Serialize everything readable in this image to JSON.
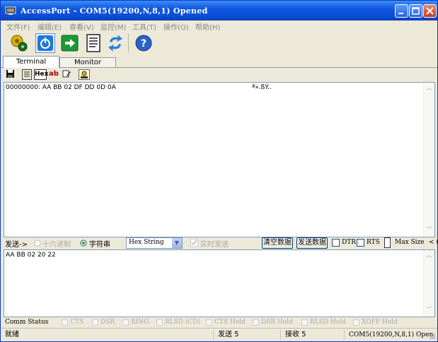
{
  "window": {
    "title": "AccessPort - COM5(19200,N,8,1) Opened"
  },
  "menu": [
    "文件(F)",
    "编辑(E)",
    "查看(V)",
    "监控(M)",
    "工具(T)",
    "操作(O)",
    "帮助(H)"
  ],
  "tabs": {
    "terminal": "Terminal",
    "monitor": "Monitor"
  },
  "subtoolbar": {
    "hex_label": "Hex",
    "ab_label": "ab"
  },
  "receive": {
    "hex_line": "00000000:  AA BB 02 DF DD 0D 0A",
    "ascii_line": "ª».ßÝ.."
  },
  "send": {
    "label": "发送->",
    "radio_hex": "十六进制",
    "radio_string": "字符串",
    "format_value": "Hex String",
    "realtime_label": "实时发送",
    "clear_button": "清空数据",
    "send_button": "发送数据",
    "dtr_label": "DTR",
    "rts_label": "RTS",
    "max_size_label": "Max Size",
    "text": "AA BB 02 20 22"
  },
  "comm_status": {
    "label": "Comm Status",
    "items": [
      "CTS",
      "DSR",
      "RING",
      "RLSD (CD)",
      "CTS Hold",
      "DSR Hold",
      "RLSD Hold",
      "XOFF Hold"
    ]
  },
  "footer": {
    "ready": "就绪",
    "sent": "发送 5",
    "received": "接收 5",
    "port": "COM5(19200,N,8,1) Open"
  },
  "colors": {
    "titlebar": "#0a4bd3",
    "panel_border": "#7f9db9",
    "window_bg": "#ece9d8"
  }
}
